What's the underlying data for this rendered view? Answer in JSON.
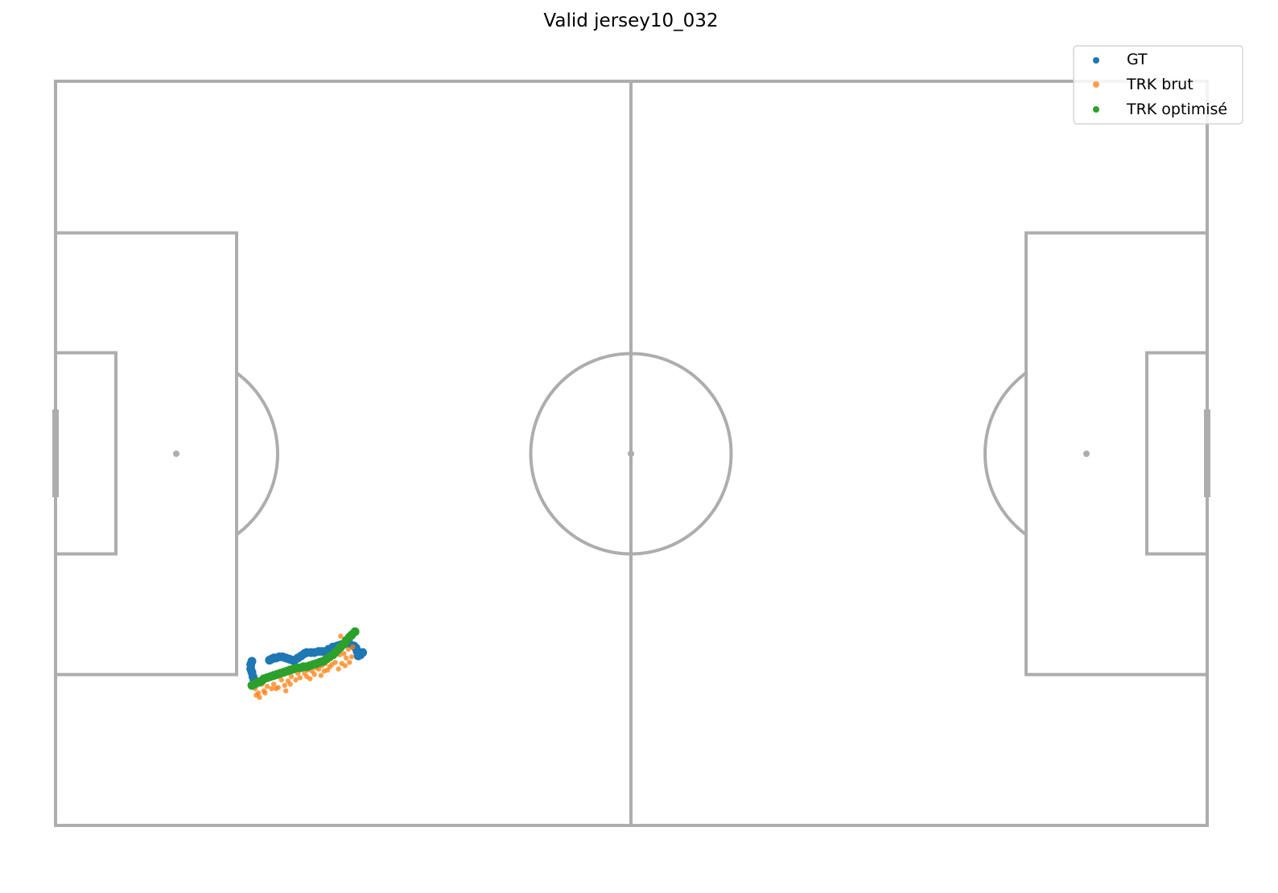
{
  "chart_data": {
    "type": "scatter",
    "title": "Valid jersey10_032",
    "pitch": {
      "length": 105,
      "width": 68
    },
    "xlim": [
      0,
      105
    ],
    "ylim": [
      0,
      68
    ],
    "axes_visible": false,
    "grid": false,
    "legend_placement": "top-right",
    "series": [
      {
        "name": "GT",
        "color": "#1f77b4",
        "points": [
          [
            28.0,
            15.8
          ],
          [
            27.8,
            15.6
          ],
          [
            27.6,
            15.5
          ],
          [
            27.5,
            15.9
          ],
          [
            27.4,
            16.2
          ],
          [
            27.2,
            16.4
          ],
          [
            26.8,
            16.6
          ],
          [
            26.4,
            16.6
          ],
          [
            26.0,
            16.5
          ],
          [
            25.7,
            16.4
          ],
          [
            25.3,
            16.3
          ],
          [
            24.9,
            16.1
          ],
          [
            24.6,
            15.9
          ],
          [
            24.3,
            15.9
          ],
          [
            24.0,
            15.9
          ],
          [
            23.6,
            15.8
          ],
          [
            23.3,
            15.8
          ],
          [
            22.9,
            15.8
          ],
          [
            22.7,
            15.7
          ],
          [
            22.4,
            15.5
          ],
          [
            22.1,
            15.3
          ],
          [
            21.8,
            15.1
          ],
          [
            21.6,
            15.1
          ],
          [
            21.3,
            15.2
          ],
          [
            21.0,
            15.3
          ],
          [
            20.7,
            15.4
          ],
          [
            20.4,
            15.4
          ],
          [
            20.1,
            15.3
          ],
          [
            19.9,
            15.3
          ],
          [
            19.7,
            15.2
          ],
          [
            19.5,
            15.1
          ],
          [
            17.9,
            15.0
          ],
          [
            17.8,
            14.7
          ],
          [
            17.8,
            14.3
          ],
          [
            17.9,
            14.0
          ],
          [
            18.0,
            13.6
          ],
          [
            18.1,
            13.3
          ],
          [
            18.2,
            13.0
          ],
          [
            18.4,
            13.1
          ],
          [
            18.6,
            13.1
          ]
        ]
      },
      {
        "name": "TRK brut",
        "color": "#ff7f0e",
        "points": [
          [
            26.5,
            15.3
          ],
          [
            26.7,
            16.1
          ],
          [
            26.3,
            15.7
          ],
          [
            26.8,
            14.9
          ],
          [
            27.0,
            15.4
          ],
          [
            26.1,
            14.8
          ],
          [
            25.9,
            15.6
          ],
          [
            26.4,
            14.6
          ],
          [
            25.5,
            14.9
          ],
          [
            25.8,
            14.3
          ],
          [
            25.2,
            14.7
          ],
          [
            25.0,
            14.5
          ],
          [
            24.6,
            14.8
          ],
          [
            24.8,
            14.2
          ],
          [
            24.3,
            14.6
          ],
          [
            24.0,
            14.3
          ],
          [
            24.5,
            14.1
          ],
          [
            23.8,
            14.4
          ],
          [
            23.4,
            14.1
          ],
          [
            23.6,
            13.8
          ],
          [
            23.0,
            14.2
          ],
          [
            22.7,
            13.9
          ],
          [
            22.9,
            13.6
          ],
          [
            22.3,
            13.5
          ],
          [
            22.1,
            13.9
          ],
          [
            21.9,
            13.3
          ],
          [
            21.5,
            13.6
          ],
          [
            21.2,
            13.2
          ],
          [
            21.4,
            12.9
          ],
          [
            20.9,
            12.8
          ],
          [
            20.6,
            13.3
          ],
          [
            20.3,
            12.6
          ],
          [
            19.9,
            12.9
          ],
          [
            19.7,
            12.5
          ],
          [
            19.3,
            12.7
          ],
          [
            19.0,
            12.3
          ],
          [
            18.8,
            12.9
          ],
          [
            18.5,
            12.1
          ],
          [
            18.2,
            12.5
          ],
          [
            18.6,
            11.7
          ],
          [
            18.3,
            11.9
          ],
          [
            19.1,
            12.1
          ],
          [
            20.1,
            12.5
          ],
          [
            21.0,
            12.3
          ],
          [
            22.5,
            14.3
          ],
          [
            26.0,
            17.3
          ],
          [
            25.6,
            15.8
          ],
          [
            27.1,
            16.3
          ],
          [
            24.2,
            13.7
          ],
          [
            23.2,
            13.4
          ]
        ]
      },
      {
        "name": "TRK optimisé",
        "color": "#2ca02c",
        "points": [
          [
            17.9,
            12.8
          ],
          [
            18.1,
            12.9
          ],
          [
            18.3,
            13.0
          ],
          [
            18.5,
            13.1
          ],
          [
            18.8,
            13.2
          ],
          [
            19.0,
            13.4
          ],
          [
            19.3,
            13.5
          ],
          [
            19.6,
            13.6
          ],
          [
            19.9,
            13.7
          ],
          [
            20.2,
            13.8
          ],
          [
            20.5,
            13.9
          ],
          [
            20.8,
            14.0
          ],
          [
            21.1,
            14.1
          ],
          [
            21.4,
            14.2
          ],
          [
            21.7,
            14.3
          ],
          [
            22.0,
            14.4
          ],
          [
            22.3,
            14.4
          ],
          [
            22.6,
            14.5
          ],
          [
            22.9,
            14.5
          ],
          [
            23.2,
            14.6
          ],
          [
            23.5,
            14.7
          ],
          [
            23.8,
            14.8
          ],
          [
            24.1,
            14.9
          ],
          [
            24.4,
            15.0
          ],
          [
            24.7,
            15.2
          ],
          [
            25.0,
            15.4
          ],
          [
            25.3,
            15.6
          ],
          [
            25.5,
            15.8
          ],
          [
            25.8,
            16.1
          ],
          [
            26.0,
            16.3
          ],
          [
            26.3,
            16.6
          ],
          [
            26.5,
            16.9
          ],
          [
            26.8,
            17.2
          ],
          [
            27.0,
            17.4
          ],
          [
            27.3,
            17.7
          ]
        ]
      }
    ]
  }
}
